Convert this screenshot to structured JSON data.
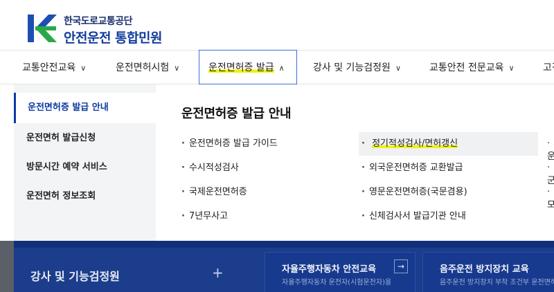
{
  "header": {
    "org_name": "한국도로교통공단",
    "site_name": "안전운전 통합민원",
    "brand_color": "#123c9c"
  },
  "nav": {
    "items": [
      {
        "label": "교통안전교육"
      },
      {
        "label": "운전면허시험"
      },
      {
        "label": "운전면허증 발급"
      },
      {
        "label": "강사 및 기능검정원"
      },
      {
        "label": "교통안전 전문교육"
      },
      {
        "label": "고객"
      }
    ],
    "active_index": 2
  },
  "mega": {
    "side_items": [
      {
        "label": "운전면허증 발급 안내"
      },
      {
        "label": "운전면허 발급신청"
      },
      {
        "label": "방문시간 예약 서비스"
      },
      {
        "label": "운전면허 정보조회"
      }
    ],
    "title": "운전면허증 발급 안내",
    "links_col1": [
      {
        "label": "운전면허증 발급 가이드"
      },
      {
        "label": "수시적성검사"
      },
      {
        "label": "국제운전면허증"
      },
      {
        "label": "7년무사고"
      }
    ],
    "links_col2": [
      {
        "label": "정기적성검사/면허갱신"
      },
      {
        "label": "외국운전면허증 교환발급"
      },
      {
        "label": "영문운전면허증(국문겸용)"
      },
      {
        "label": "신체검사서 발급기관 안내"
      }
    ],
    "links_col3_clipped": [
      {
        "label": "운"
      },
      {
        "label": "군"
      },
      {
        "label": "모"
      }
    ]
  },
  "background_section": {
    "title": "강사 및 기능검정원",
    "plus": "+",
    "cards": [
      {
        "title": "자율주행자동차 안전교육",
        "desc": "자율주행자동차 운전자(시험운전자)을",
        "arrow": "→"
      },
      {
        "title": "음주운전 방지장치 교육",
        "desc": "음주운전 방지장치 부착 조건부 운전면허"
      }
    ]
  }
}
